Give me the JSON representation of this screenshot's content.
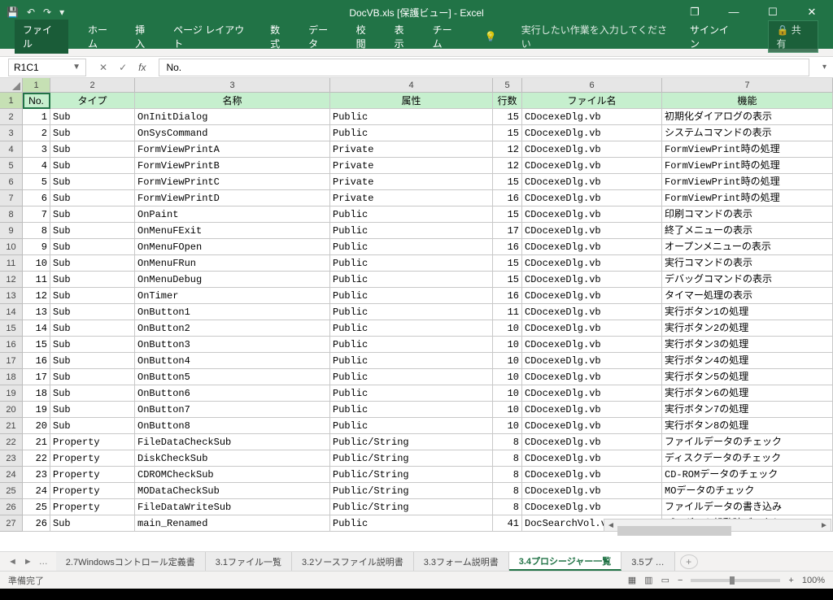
{
  "title": "DocVB.xls  [保護ビュー] - Excel",
  "qat": {
    "save": "💾",
    "undo": "↶",
    "redo": "↷",
    "more": "▾"
  },
  "winctl": {
    "restore": "❐",
    "min": "—",
    "max": "☐",
    "close": "✕"
  },
  "ribbon": [
    "ファイル",
    "ホーム",
    "挿入",
    "ページ レイアウト",
    "数式",
    "データ",
    "校閲",
    "表示",
    "チーム"
  ],
  "tellme_icon": "💡",
  "tellme": "実行したい作業を入力してください",
  "signin": "サインイン",
  "share": "🔒 共有",
  "namebox": "R1C1",
  "fx_btns": {
    "cancel": "✕",
    "enter": "✓"
  },
  "fx_label": "fx",
  "fx_value": "No.",
  "col_numbers": [
    "1",
    "2",
    "3",
    "4",
    "5",
    "6",
    "7"
  ],
  "headers": [
    "No.",
    "タイプ",
    "名称",
    "属性",
    "行数",
    "ファイル名",
    "機能"
  ],
  "rows": [
    [
      1,
      "Sub",
      "OnInitDialog",
      "Public",
      15,
      "CDocexeDlg.vb",
      "初期化ダイアログの表示"
    ],
    [
      2,
      "Sub",
      "OnSysCommand",
      "Public",
      15,
      "CDocexeDlg.vb",
      "システムコマンドの表示"
    ],
    [
      3,
      "Sub",
      "FormViewPrintA",
      "Private",
      12,
      "CDocexeDlg.vb",
      "FormViewPrint時の処理"
    ],
    [
      4,
      "Sub",
      "FormViewPrintB",
      "Private",
      12,
      "CDocexeDlg.vb",
      "FormViewPrint時の処理"
    ],
    [
      5,
      "Sub",
      "FormViewPrintC",
      "Private",
      15,
      "CDocexeDlg.vb",
      "FormViewPrint時の処理"
    ],
    [
      6,
      "Sub",
      "FormViewPrintD",
      "Private",
      16,
      "CDocexeDlg.vb",
      "FormViewPrint時の処理"
    ],
    [
      7,
      "Sub",
      "OnPaint",
      "Public",
      15,
      "CDocexeDlg.vb",
      "印刷コマンドの表示"
    ],
    [
      8,
      "Sub",
      "OnMenuFExit",
      "Public",
      17,
      "CDocexeDlg.vb",
      "終了メニューの表示"
    ],
    [
      9,
      "Sub",
      "OnMenuFOpen",
      "Public",
      16,
      "CDocexeDlg.vb",
      "オープンメニューの表示"
    ],
    [
      10,
      "Sub",
      "OnMenuFRun",
      "Public",
      15,
      "CDocexeDlg.vb",
      "実行コマンドの表示"
    ],
    [
      11,
      "Sub",
      "OnMenuDebug",
      "Public",
      15,
      "CDocexeDlg.vb",
      "デバッグコマンドの表示"
    ],
    [
      12,
      "Sub",
      "OnTimer",
      "Public",
      16,
      "CDocexeDlg.vb",
      "タイマー処理の表示"
    ],
    [
      13,
      "Sub",
      "OnButton1",
      "Public",
      11,
      "CDocexeDlg.vb",
      "実行ボタン1の処理"
    ],
    [
      14,
      "Sub",
      "OnButton2",
      "Public",
      10,
      "CDocexeDlg.vb",
      "実行ボタン2の処理"
    ],
    [
      15,
      "Sub",
      "OnButton3",
      "Public",
      10,
      "CDocexeDlg.vb",
      "実行ボタン3の処理"
    ],
    [
      16,
      "Sub",
      "OnButton4",
      "Public",
      10,
      "CDocexeDlg.vb",
      "実行ボタン4の処理"
    ],
    [
      17,
      "Sub",
      "OnButton5",
      "Public",
      10,
      "CDocexeDlg.vb",
      "実行ボタン5の処理"
    ],
    [
      18,
      "Sub",
      "OnButton6",
      "Public",
      10,
      "CDocexeDlg.vb",
      "実行ボタン6の処理"
    ],
    [
      19,
      "Sub",
      "OnButton7",
      "Public",
      10,
      "CDocexeDlg.vb",
      "実行ボタン7の処理"
    ],
    [
      20,
      "Sub",
      "OnButton8",
      "Public",
      10,
      "CDocexeDlg.vb",
      "実行ボタン8の処理"
    ],
    [
      21,
      "Property",
      "FileDataCheckSub",
      "Public/String",
      8,
      "CDocexeDlg.vb",
      "ファイルデータのチェック"
    ],
    [
      22,
      "Property",
      "DiskCheckSub",
      "Public/String",
      8,
      "CDocexeDlg.vb",
      "ディスクデータのチェック"
    ],
    [
      23,
      "Property",
      "CDROMCheckSub",
      "Public/String",
      8,
      "CDocexeDlg.vb",
      "CD-ROMデータのチェック"
    ],
    [
      24,
      "Property",
      "MODataCheckSub",
      "Public/String",
      8,
      "CDocexeDlg.vb",
      "MOデータのチェック"
    ],
    [
      25,
      "Property",
      "FileDataWriteSub",
      "Public/String",
      8,
      "CDocexeDlg.vb",
      "ファイルデータの書き込み"
    ],
    [
      26,
      "Sub",
      "main_Renamed",
      "Public",
      41,
      "DocSearchVol.vb",
      "プログラム起動時データセ"
    ]
  ],
  "tabnav": [
    "◄",
    "►",
    "…"
  ],
  "tabs": [
    "2.7Windowsコントロール定義書",
    "3.1ファイル一覧",
    "3.2ソースファイル説明書",
    "3.3フォーム説明書",
    "3.4プロシージャー一覧",
    "3.5プ …"
  ],
  "active_tab": 4,
  "status": "準備完了",
  "zoom": "100%",
  "zoom_minus": "−",
  "zoom_plus": "+",
  "views": [
    "▦",
    "▥",
    "▭"
  ]
}
